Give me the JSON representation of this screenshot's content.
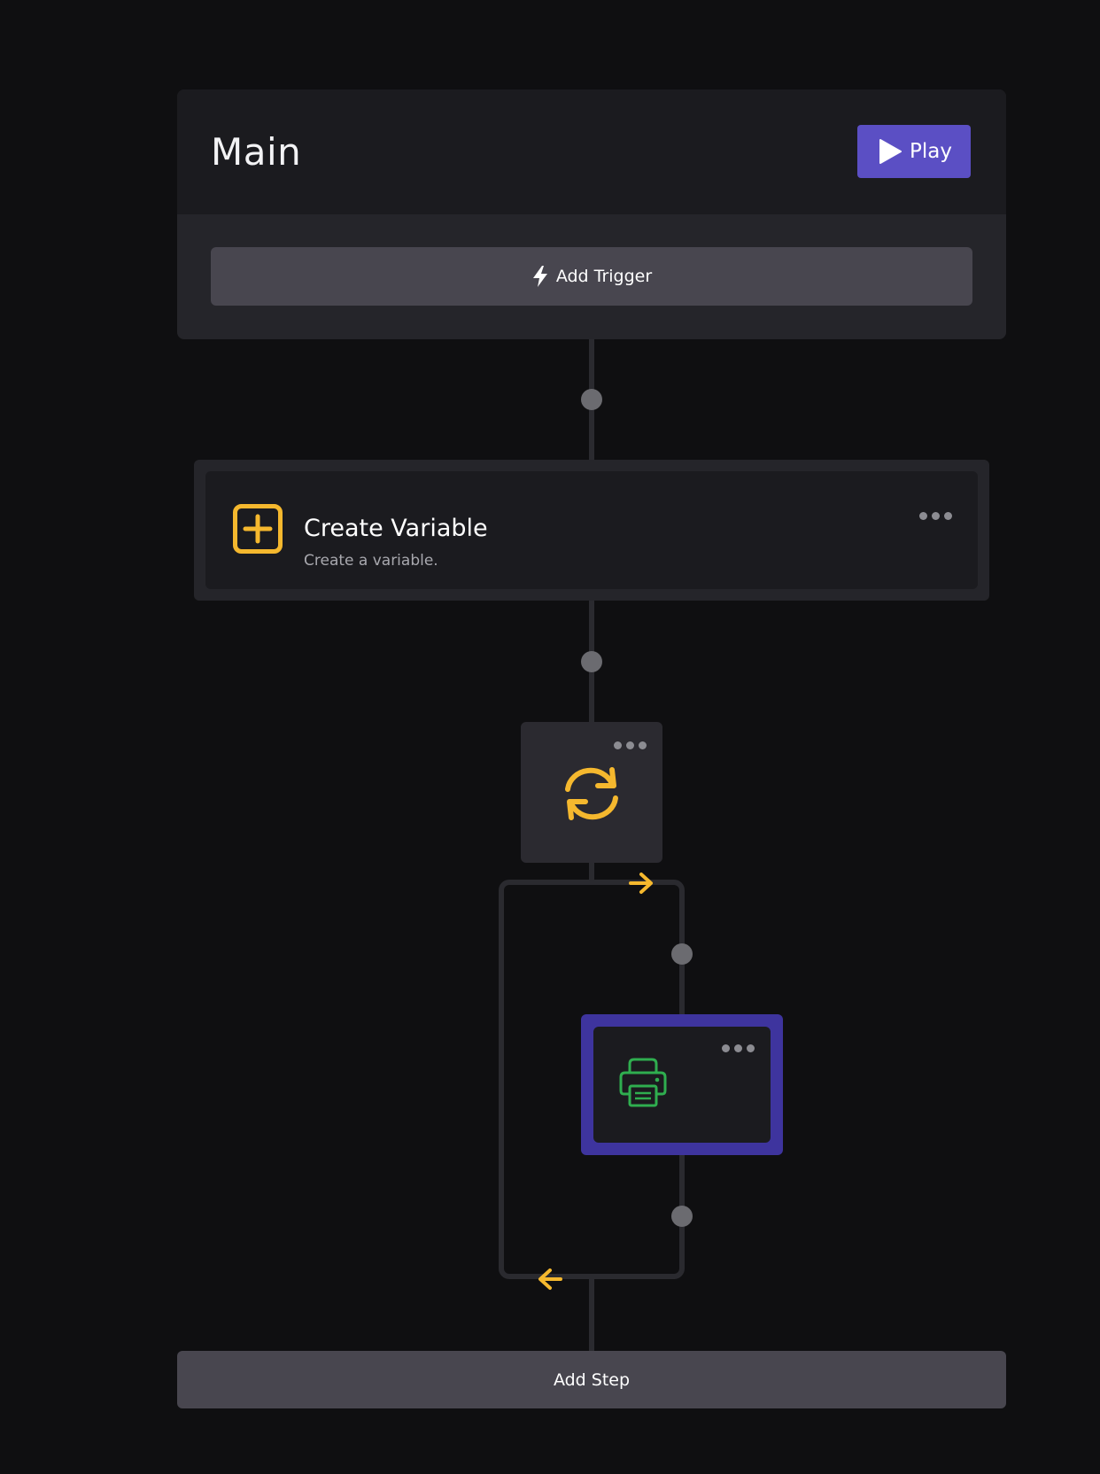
{
  "header": {
    "title": "Main",
    "play_label": "Play"
  },
  "trigger": {
    "add_label": "Add Trigger",
    "icon": "bolt-icon"
  },
  "steps": [
    {
      "title": "Create Variable",
      "description": "Create a variable.",
      "icon": "plus-square-icon",
      "icon_color": "#f5b82e"
    },
    {
      "type": "loop",
      "icon": "refresh-icon",
      "icon_color": "#f5b82e",
      "children": [
        {
          "type": "print",
          "icon": "printer-icon",
          "icon_color": "#2fae4f",
          "selected": true
        }
      ]
    }
  ],
  "footer": {
    "add_step_label": "Add Step"
  },
  "colors": {
    "background": "#0f0f11",
    "accent": "#5b4fc4",
    "loop_arrow": "#f5b82e",
    "selected_border": "#3e349e"
  }
}
